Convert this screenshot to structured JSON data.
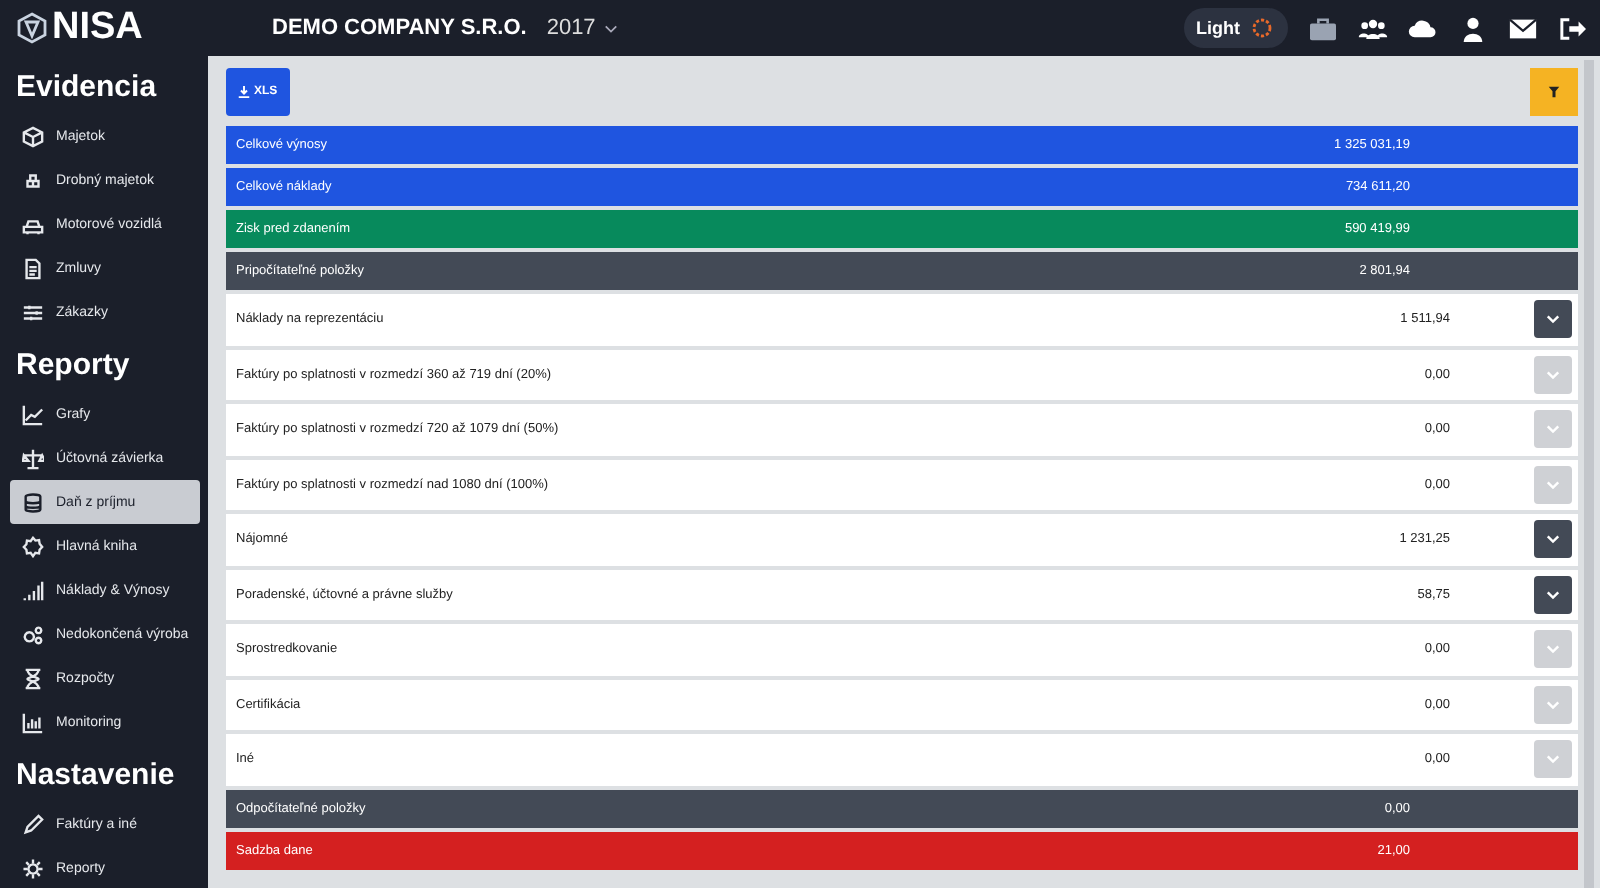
{
  "header": {
    "logo": "NISA",
    "company": "DEMO COMPANY S.R.O.",
    "year": "2017",
    "theme_label": "Light"
  },
  "sidebar": {
    "sections": [
      {
        "title": "Evidencia",
        "items": [
          {
            "label": "Majetok",
            "selected": false
          },
          {
            "label": "Drobný majetok",
            "selected": false
          },
          {
            "label": "Motorové vozidlá",
            "selected": false
          },
          {
            "label": "Zmluvy",
            "selected": false
          },
          {
            "label": "Zákazky",
            "selected": false
          }
        ]
      },
      {
        "title": "Reporty",
        "items": [
          {
            "label": "Grafy",
            "selected": false
          },
          {
            "label": "Účtovná závierka",
            "selected": false
          },
          {
            "label": "Daň z príjmu",
            "selected": true
          },
          {
            "label": "Hlavná kniha",
            "selected": false
          },
          {
            "label": "Náklady & Výnosy",
            "selected": false
          },
          {
            "label": "Nedokončená výroba",
            "selected": false
          },
          {
            "label": "Rozpočty",
            "selected": false
          },
          {
            "label": "Monitoring",
            "selected": false
          }
        ]
      },
      {
        "title": "Nastavenie",
        "items": [
          {
            "label": "Faktúry a iné",
            "selected": false
          },
          {
            "label": "Reporty",
            "selected": false
          }
        ]
      }
    ]
  },
  "toolbar": {
    "export_button": "XLS"
  },
  "rows": [
    {
      "kind": "summary",
      "label": "Celkové výnosy",
      "value": "1 325 031,19",
      "color": "#1f55e0"
    },
    {
      "kind": "summary",
      "label": "Celkové náklady",
      "value": "734 611,20",
      "color": "#1f55e0"
    },
    {
      "kind": "summary",
      "label": "Zisk pred zdanením",
      "value": "590 419,99",
      "color": "#078a5c"
    },
    {
      "kind": "summary",
      "label": "Pripočítateľné položky",
      "value": "2 801,94",
      "color": "#434a56"
    },
    {
      "kind": "item",
      "label": "Náklady na reprezentáciu",
      "value": "1 511,94",
      "disabled": false
    },
    {
      "kind": "item",
      "label": "Faktúry po splatnosti v rozmedzí 360 až 719 dní (20%)",
      "value": "0,00",
      "disabled": true
    },
    {
      "kind": "item",
      "label": "Faktúry po splatnosti v rozmedzí 720 až 1079 dní (50%)",
      "value": "0,00",
      "disabled": true
    },
    {
      "kind": "item",
      "label": "Faktúry po splatnosti v rozmedzí nad 1080 dní (100%)",
      "value": "0,00",
      "disabled": true
    },
    {
      "kind": "item",
      "label": "Nájomné",
      "value": "1 231,25",
      "disabled": false
    },
    {
      "kind": "item",
      "label": "Poradenské, účtovné a právne služby",
      "value": "58,75",
      "disabled": false
    },
    {
      "kind": "item",
      "label": "Sprostredkovanie",
      "value": "0,00",
      "disabled": true
    },
    {
      "kind": "item",
      "label": "Certifikácia",
      "value": "0,00",
      "disabled": true
    },
    {
      "kind": "item",
      "label": "Iné",
      "value": "0,00",
      "disabled": true
    },
    {
      "kind": "summary",
      "label": "Odpočítateľné položky",
      "value": "0,00",
      "color": "#434a56"
    },
    {
      "kind": "summary",
      "label": "Sadzba dane",
      "value": "21,00",
      "color": "#d42020"
    }
  ]
}
